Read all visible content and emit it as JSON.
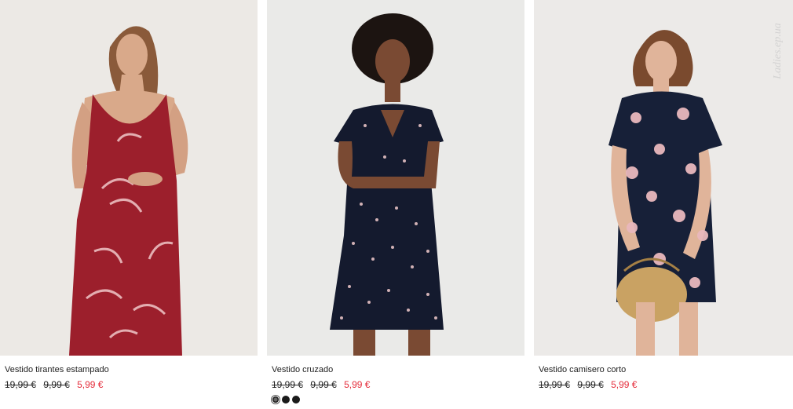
{
  "watermark": "Ladies.ep.ua",
  "products": [
    {
      "name": "Vestido tirantes estampado",
      "price_original": "19,99 €",
      "price_previous": "9,99 €",
      "price_sale": "5,99 €",
      "dress_color": "#9c1f2c",
      "swatches": []
    },
    {
      "name": "Vestido cruzado",
      "price_original": "19,99 €",
      "price_previous": "9,99 €",
      "price_sale": "5,99 €",
      "dress_color": "#141a2e",
      "swatches": [
        "#1a1a1a",
        "#1a1a1a",
        "#1a1a1a"
      ]
    },
    {
      "name": "Vestido camisero corto",
      "price_original": "19,99 €",
      "price_previous": "9,99 €",
      "price_sale": "5,99 €",
      "dress_color": "#172038",
      "swatches": []
    }
  ],
  "colors": {
    "sale_price": "#e52e3c",
    "photo_bg": "#e9e8e6"
  }
}
